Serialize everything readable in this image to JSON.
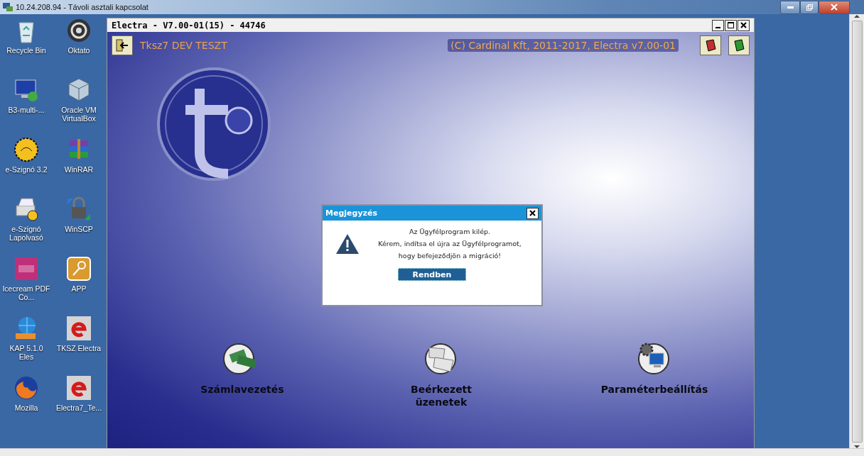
{
  "remote_session": {
    "title": "10.24.208.94 - Távoli asztali kapcsolat"
  },
  "desktop_icons": [
    {
      "label": "Recycle Bin",
      "kind": "recycle"
    },
    {
      "label": "Oktato",
      "kind": "swirl"
    },
    {
      "label": "B3-multi-...",
      "kind": "monitor"
    },
    {
      "label": "Oracle VM VirtualBox",
      "kind": "cube"
    },
    {
      "label": "e-Szignó 3.2",
      "kind": "seal"
    },
    {
      "label": "WinRAR",
      "kind": "books"
    },
    {
      "label": "e-Szignó Lapolvasó",
      "kind": "scanner"
    },
    {
      "label": "WinSCP",
      "kind": "lock"
    },
    {
      "label": "Icecream PDF Co...",
      "kind": "pdf"
    },
    {
      "label": "APP",
      "kind": "key"
    },
    {
      "label": "KAP 5.1.0 Eles",
      "kind": "globe"
    },
    {
      "label": "TKSZ Electra",
      "kind": "electra"
    },
    {
      "label": "Mozilla",
      "kind": "firefox"
    },
    {
      "label": "Electra7_Te...",
      "kind": "electra"
    }
  ],
  "app_window": {
    "title": "Electra - V7.00-01(15) - 44746",
    "header_title": "Tksz7 DEV TESZT",
    "copyright": "(C) Cardinal Kft, 2011-2017, Electra v7.00-01",
    "menu": [
      {
        "label": "Számlavezetés",
        "kind": "money"
      },
      {
        "label": "Beérkezett üzenetek",
        "kind": "mail"
      },
      {
        "label": "Paraméterbeállítás",
        "kind": "settings"
      }
    ]
  },
  "dialog": {
    "title": "Megjegyzés",
    "lines": [
      "Az Ügyfélprogram kilép.",
      "Kérem, indítsa el újra az Ügyfélprogramot,",
      "hogy befejeződjön a migráció!"
    ],
    "button": "Rendben"
  }
}
